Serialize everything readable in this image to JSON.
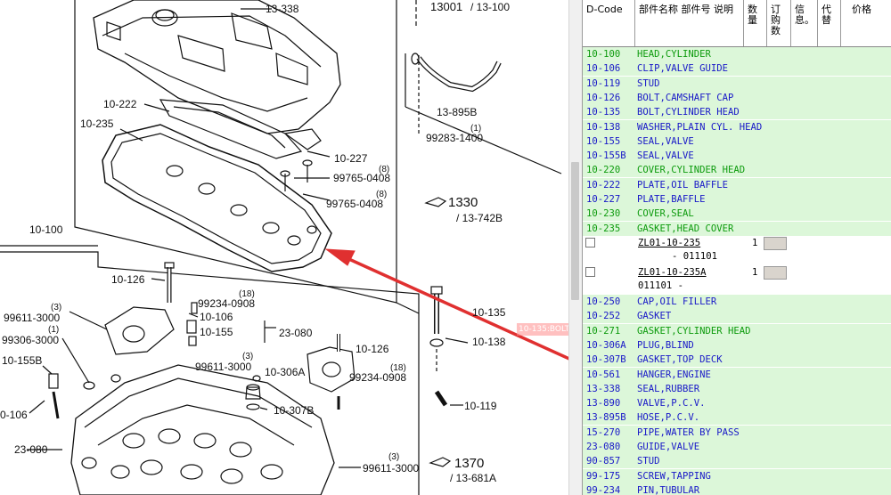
{
  "diagram": {
    "labels": {
      "l13338": "13-338",
      "l13001": "13001",
      "l13100": "/ 13-100",
      "l10222": "10-222",
      "l10235": "10-235",
      "l13895b": "13-895B",
      "l1": "(1)",
      "l99283": "99283-1400",
      "l10227": "10-227",
      "l8a": "(8)",
      "l99765a": "99765-0408",
      "l8b": "(8)",
      "l99765b": "99765-0408",
      "l1330": "1330",
      "l13742b": "/ 13-742B",
      "l10100": "10-100",
      "l10126a": "10-126",
      "l18a": "(18)",
      "l99234a": "99234-0908",
      "l10106": "10-106",
      "l10155": "10-155",
      "l23080a": "23-080",
      "l10135": "10-135",
      "l3a": "(3)",
      "l99611a": "99611-3000",
      "l1b": "(1)",
      "l99306": "99306-3000",
      "l10126b": "10-126",
      "l10138": "10-138",
      "l10155b": "10-155B",
      "l3b": "(3)",
      "l99611b": "99611-3000",
      "l10306a": "10-306A",
      "l18b": "(18)",
      "l99234b": "99234-0908",
      "l10106b": "0-106",
      "l10307b": "10-307B",
      "l10119": "10-119",
      "l23080b": "23-080",
      "l3c": "(3)",
      "l99611c": "99611-3000",
      "l1370": "1370",
      "l13681a": "/ 13-681A"
    },
    "tooltip": "10-135:BOLT,CYLINDER HEAD"
  },
  "parts_table": {
    "headers": {
      "dcode": "D-Code",
      "name": "部件名称 部件号 说明",
      "qty": "数量",
      "order_qty": "订购数",
      "info": "信息。",
      "replace": "代替",
      "price": "价格"
    },
    "rows": [
      {
        "code": "10-100",
        "name": "HEAD,CYLINDER",
        "color": "green"
      },
      {
        "code": "10-106",
        "name": "CLIP,VALVE GUIDE",
        "color": "blue"
      },
      {
        "code": "10-119",
        "name": "STUD",
        "color": "blue"
      },
      {
        "code": "10-126",
        "name": "BOLT,CAMSHAFT CAP",
        "color": "blue"
      },
      {
        "code": "10-135",
        "name": "BOLT,CYLINDER HEAD",
        "color": "blue"
      },
      {
        "code": "10-138",
        "name": "WASHER,PLAIN CYL. HEAD",
        "color": "blue"
      },
      {
        "code": "10-155",
        "name": "SEAL,VALVE",
        "color": "blue"
      },
      {
        "code": "10-155B",
        "name": "SEAL,VALVE",
        "color": "blue"
      },
      {
        "code": "10-220",
        "name": "COVER,CYLINDER HEAD",
        "color": "green"
      },
      {
        "code": "10-222",
        "name": "PLATE,OIL BAFFLE",
        "color": "blue"
      },
      {
        "code": "10-227",
        "name": "PLATE,BAFFLE",
        "color": "blue"
      },
      {
        "code": "10-230",
        "name": "COVER,SEAL",
        "color": "green"
      },
      {
        "code": "10-235",
        "name": "GASKET,HEAD COVER",
        "color": "green"
      }
    ],
    "sub_items": [
      {
        "part_no": "ZL01-10-235",
        "qty": "1",
        "line2": "- 011101"
      },
      {
        "part_no": "ZL01-10-235A",
        "qty": "1",
        "line2": "011101 -"
      }
    ],
    "rows_after": [
      {
        "code": "10-250",
        "name": "CAP,OIL FILLER",
        "color": "blue"
      },
      {
        "code": "10-252",
        "name": "GASKET",
        "color": "blue"
      },
      {
        "code": "10-271",
        "name": "GASKET,CYLINDER HEAD",
        "color": "green"
      },
      {
        "code": "10-306A",
        "name": "PLUG,BLIND",
        "color": "blue"
      },
      {
        "code": "10-307B",
        "name": "GASKET,TOP DECK",
        "color": "blue"
      },
      {
        "code": "10-561",
        "name": "HANGER,ENGINE",
        "color": "blue"
      },
      {
        "code": "13-338",
        "name": "SEAL,RUBBER",
        "color": "blue"
      },
      {
        "code": "13-890",
        "name": "VALVE,P.C.V.",
        "color": "blue"
      },
      {
        "code": "13-895B",
        "name": "HOSE,P.C.V.",
        "color": "blue"
      },
      {
        "code": "15-270",
        "name": "PIPE,WATER BY PASS",
        "color": "blue"
      },
      {
        "code": "23-080",
        "name": "GUIDE,VALVE",
        "color": "blue"
      },
      {
        "code": "90-857",
        "name": "STUD",
        "color": "blue"
      },
      {
        "code": "99-175",
        "name": "SCREW,TAPPING",
        "color": "blue"
      },
      {
        "code": "99-234",
        "name": "PIN,TUBULAR",
        "color": "blue"
      }
    ]
  },
  "colors": {
    "row_bg": "#dcf7d9",
    "text_green": "#0d9b0d",
    "text_blue": "#1818c8",
    "arrow": "#e03030"
  }
}
